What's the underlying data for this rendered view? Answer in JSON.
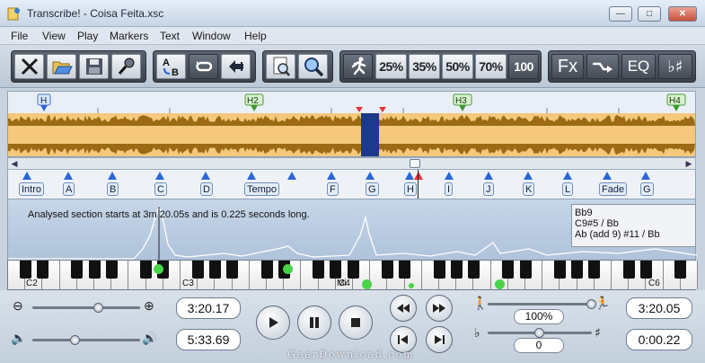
{
  "window": {
    "title": "Transcribe! - Coisa Feita.xsc"
  },
  "menu": [
    "File",
    "View",
    "Play",
    "Markers",
    "Text",
    "Window",
    "Help"
  ],
  "toolbar": {
    "speeds": [
      "25%",
      "35%",
      "50%",
      "70%",
      "100"
    ],
    "fx_label": "Fx",
    "eq_label": "EQ",
    "key_label": "♭♯"
  },
  "sections": [
    "H",
    "H2",
    "H3",
    "H4"
  ],
  "markers": [
    "Intro",
    "A",
    "B",
    "C",
    "D",
    "Tempo",
    "F",
    "G",
    "H",
    "I",
    "J",
    "K",
    "L",
    "Fade",
    "G"
  ],
  "analysis": {
    "message": "Analysed section starts at 3m 20.05s and is 0.225 seconds long."
  },
  "chords": [
    "Bb9",
    "C9#5 / Bb",
    "Ab (add 9) #11 / Bb"
  ],
  "keyboard": {
    "octave_labels": [
      "C2",
      "C3",
      "C4",
      "C6"
    ],
    "mid_label": "Mi"
  },
  "playback": {
    "position_time": "3:20.17",
    "total_time": "5:33.69",
    "speed_value": "100%",
    "pitch_value": "0",
    "section_start": "3:20.05",
    "section_length": "0:00.22",
    "speed_level": 1.0,
    "pitch_level": 0.5,
    "zoom_level": 0.62,
    "volume_level": 0.4
  },
  "watermark": "GearDownload.com"
}
